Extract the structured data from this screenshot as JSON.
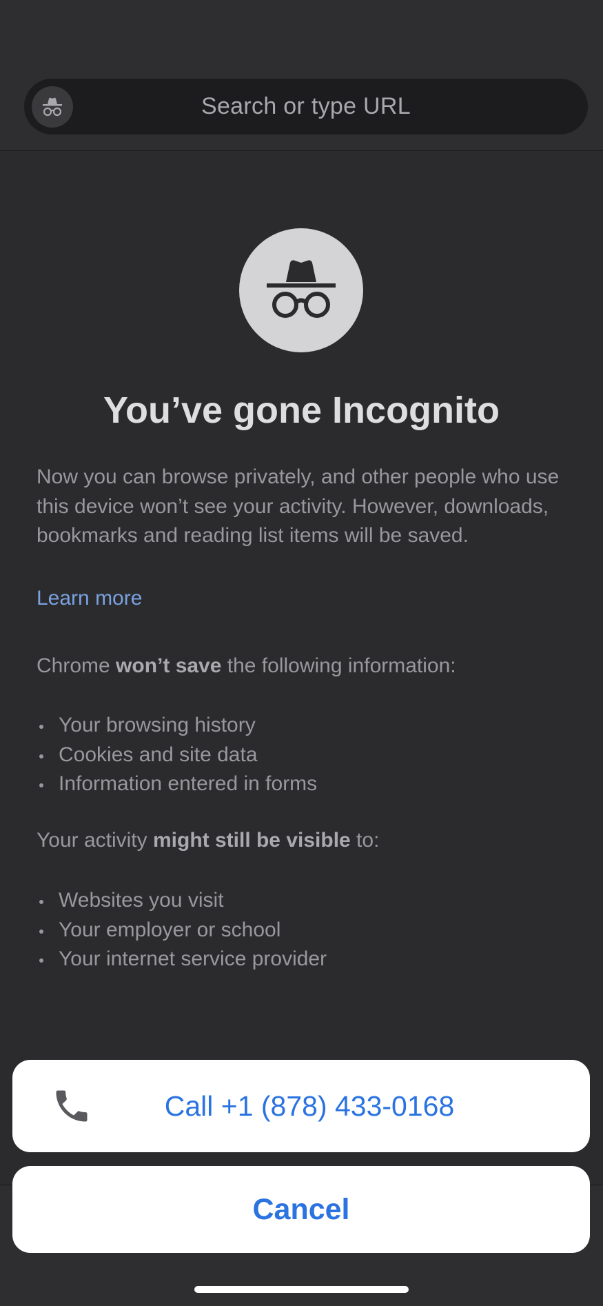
{
  "search": {
    "placeholder": "Search or type URL"
  },
  "incognito": {
    "title": "You’ve gone Incognito",
    "description": "Now you can browse privately, and other people who use this device won’t see your activity. However, downloads, bookmarks and reading list items will be saved.",
    "learn_more": "Learn more",
    "wont_save_prefix": "Chrome ",
    "wont_save_bold": "won’t save",
    "wont_save_suffix": " the following information:",
    "wont_save_items": [
      "Your browsing history",
      "Cookies and site data",
      "Information entered in forms"
    ],
    "visible_prefix": "Your activity ",
    "visible_bold": "might still be visible",
    "visible_suffix": " to:",
    "visible_items": [
      "Websites you visit",
      "Your employer or school",
      "Your internet service provider"
    ]
  },
  "action_sheet": {
    "call_label": "Call +1 (878) 433-0168",
    "cancel_label": "Cancel"
  },
  "icons": {
    "omnibox": "incognito-icon",
    "hero": "incognito-icon",
    "call": "phone-icon"
  },
  "colors": {
    "background": "#2b2b2d",
    "link": "#7aa1e0",
    "action": "#2a73e0"
  }
}
